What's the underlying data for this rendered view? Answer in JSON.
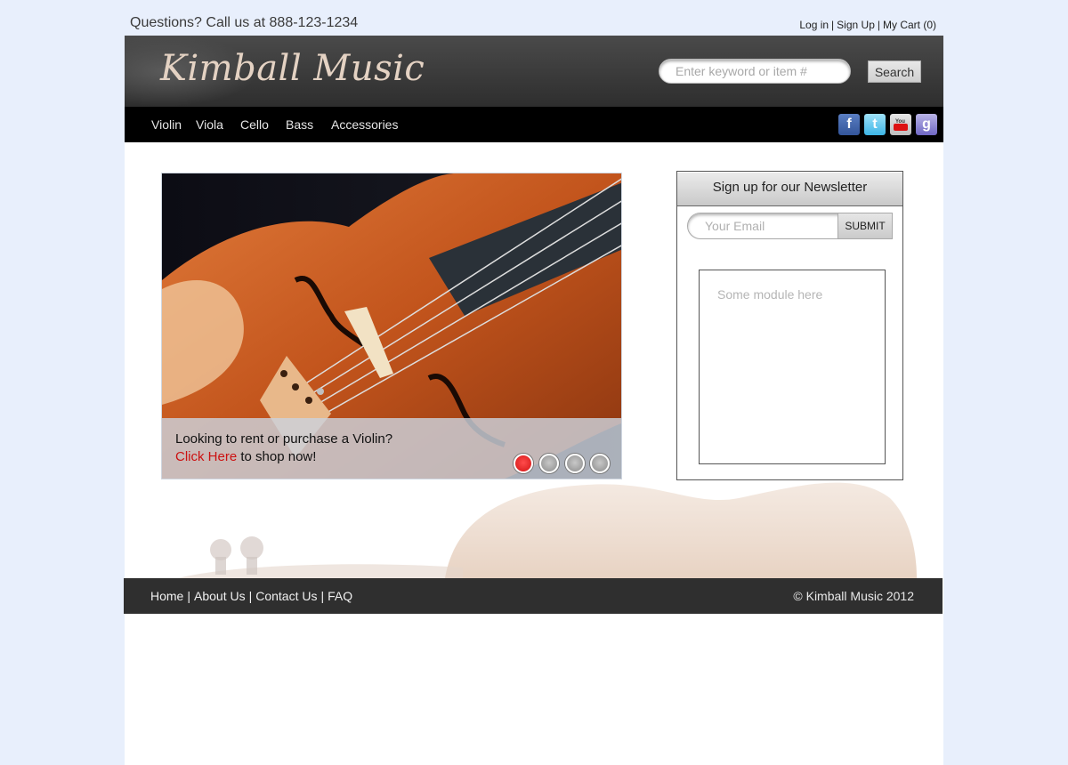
{
  "topbar": {
    "phone": "Questions? Call us at 888-123-1234",
    "login": "Log in",
    "signup": "Sign Up",
    "cart": "My Cart (0)",
    "separator": "|"
  },
  "header": {
    "logo": "Kimball Music",
    "search_placeholder": "Enter keyword or item #",
    "search_button": "Search"
  },
  "nav": {
    "items": [
      "Violin",
      "Viola",
      "Cello",
      "Bass",
      "Accessories"
    ],
    "social": [
      "facebook-icon",
      "twitter-icon",
      "youtube-icon",
      "google-icon"
    ]
  },
  "hero": {
    "line1": "Looking to rent or purchase a Violin?",
    "link": "Click Here",
    "line2_rest": " to shop now!",
    "slides": 4,
    "active_slide": 1
  },
  "newsletter": {
    "title": "Sign up for our Newsletter",
    "email_placeholder": "Your Email",
    "submit": "SUBMIT",
    "module_text": "Some module here"
  },
  "footer": {
    "links": [
      "Home",
      "About Us",
      "Contact Us",
      "FAQ"
    ],
    "separator": "|",
    "copyright": "© Kimball Music 2012"
  },
  "colors": {
    "page_bg": "#e8effc",
    "header": "#3a3a3a",
    "nav": "#000000",
    "link_red": "#cc1111",
    "footer": "#2f2f2f"
  }
}
